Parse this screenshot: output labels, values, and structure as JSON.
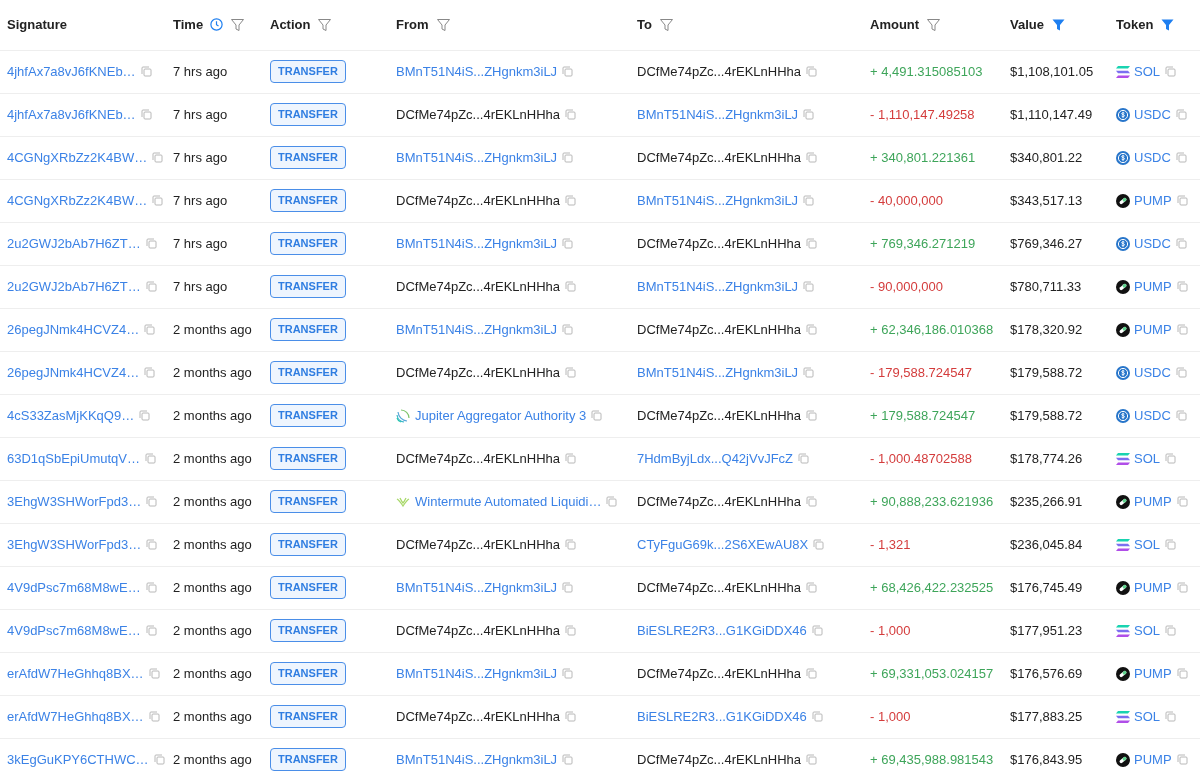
{
  "columns": [
    {
      "label": "Signature",
      "filterable": false,
      "sorted": false
    },
    {
      "label": "Time",
      "filterable": true,
      "filter_active": false,
      "sorted": true
    },
    {
      "label": "Action",
      "filterable": true,
      "filter_active": false,
      "sorted": false
    },
    {
      "label": "From",
      "filterable": true,
      "filter_active": false,
      "sorted": false
    },
    {
      "label": "To",
      "filterable": true,
      "filter_active": false,
      "sorted": false
    },
    {
      "label": "Amount",
      "filterable": true,
      "filter_active": false,
      "sorted": false
    },
    {
      "label": "Value",
      "filterable": true,
      "filter_active": true,
      "sorted": false
    },
    {
      "label": "Token",
      "filterable": true,
      "filter_active": true,
      "sorted": false
    }
  ],
  "rows": [
    {
      "signature": "4jhfAx7a8vJ6fKNEb…",
      "time": "7 hrs ago",
      "action": "TRANSFER",
      "from": {
        "text": "BMnT51N4iS...ZHgnkm3iLJ",
        "link": true
      },
      "to": {
        "text": "DCfMe74pZc...4rEKLnHHha",
        "link": false
      },
      "amount": "+ 4,491.315085103",
      "incoming": true,
      "value": "$1,108,101.05",
      "token": {
        "symbol": "SOL",
        "kind": "sol"
      }
    },
    {
      "signature": "4jhfAx7a8vJ6fKNEb…",
      "time": "7 hrs ago",
      "action": "TRANSFER",
      "from": {
        "text": "DCfMe74pZc...4rEKLnHHha",
        "link": false
      },
      "to": {
        "text": "BMnT51N4iS...ZHgnkm3iLJ",
        "link": true
      },
      "amount": "- 1,110,147.49258",
      "incoming": false,
      "value": "$1,110,147.49",
      "token": {
        "symbol": "USDC",
        "kind": "usdc"
      }
    },
    {
      "signature": "4CGNgXRbZz2K4BW…",
      "time": "7 hrs ago",
      "action": "TRANSFER",
      "from": {
        "text": "BMnT51N4iS...ZHgnkm3iLJ",
        "link": true
      },
      "to": {
        "text": "DCfMe74pZc...4rEKLnHHha",
        "link": false
      },
      "amount": "+ 340,801.221361",
      "incoming": true,
      "value": "$340,801.22",
      "token": {
        "symbol": "USDC",
        "kind": "usdc"
      }
    },
    {
      "signature": "4CGNgXRbZz2K4BW…",
      "time": "7 hrs ago",
      "action": "TRANSFER",
      "from": {
        "text": "DCfMe74pZc...4rEKLnHHha",
        "link": false
      },
      "to": {
        "text": "BMnT51N4iS...ZHgnkm3iLJ",
        "link": true
      },
      "amount": "- 40,000,000",
      "incoming": false,
      "value": "$343,517.13",
      "token": {
        "symbol": "PUMP",
        "kind": "pump"
      }
    },
    {
      "signature": "2u2GWJ2bAb7H6ZT…",
      "time": "7 hrs ago",
      "action": "TRANSFER",
      "from": {
        "text": "BMnT51N4iS...ZHgnkm3iLJ",
        "link": true
      },
      "to": {
        "text": "DCfMe74pZc...4rEKLnHHha",
        "link": false
      },
      "amount": "+ 769,346.271219",
      "incoming": true,
      "value": "$769,346.27",
      "token": {
        "symbol": "USDC",
        "kind": "usdc"
      }
    },
    {
      "signature": "2u2GWJ2bAb7H6ZT…",
      "time": "7 hrs ago",
      "action": "TRANSFER",
      "from": {
        "text": "DCfMe74pZc...4rEKLnHHha",
        "link": false
      },
      "to": {
        "text": "BMnT51N4iS...ZHgnkm3iLJ",
        "link": true
      },
      "amount": "- 90,000,000",
      "incoming": false,
      "value": "$780,711.33",
      "token": {
        "symbol": "PUMP",
        "kind": "pump"
      }
    },
    {
      "signature": "26pegJNmk4HCVZ4…",
      "time": "2 months ago",
      "action": "TRANSFER",
      "from": {
        "text": "BMnT51N4iS...ZHgnkm3iLJ",
        "link": true
      },
      "to": {
        "text": "DCfMe74pZc...4rEKLnHHha",
        "link": false
      },
      "amount": "+ 62,346,186.010368",
      "incoming": true,
      "value": "$178,320.92",
      "token": {
        "symbol": "PUMP",
        "kind": "pump"
      }
    },
    {
      "signature": "26pegJNmk4HCVZ4…",
      "time": "2 months ago",
      "action": "TRANSFER",
      "from": {
        "text": "DCfMe74pZc...4rEKLnHHha",
        "link": false
      },
      "to": {
        "text": "BMnT51N4iS...ZHgnkm3iLJ",
        "link": true
      },
      "amount": "- 179,588.724547",
      "incoming": false,
      "value": "$179,588.72",
      "token": {
        "symbol": "USDC",
        "kind": "usdc"
      }
    },
    {
      "signature": "4cS33ZasMjKKqQ9…",
      "time": "2 months ago",
      "action": "TRANSFER",
      "from": {
        "text": "Jupiter Aggregator Authority 3",
        "link": true,
        "kind": "jupiter"
      },
      "to": {
        "text": "DCfMe74pZc...4rEKLnHHha",
        "link": false
      },
      "amount": "+ 179,588.724547",
      "incoming": true,
      "value": "$179,588.72",
      "token": {
        "symbol": "USDC",
        "kind": "usdc"
      }
    },
    {
      "signature": "63D1qSbEpiUmutqV…",
      "time": "2 months ago",
      "action": "TRANSFER",
      "from": {
        "text": "DCfMe74pZc...4rEKLnHHha",
        "link": false
      },
      "to": {
        "text": "7HdmByjLdx...Q42jVvJFcZ",
        "link": true
      },
      "amount": "- 1,000.48702588",
      "incoming": false,
      "value": "$178,774.26",
      "token": {
        "symbol": "SOL",
        "kind": "sol"
      }
    },
    {
      "signature": "3EhgW3SHWorFpd3…",
      "time": "2 months ago",
      "action": "TRANSFER",
      "from": {
        "text": "Wintermute Automated Liquidi…",
        "link": true,
        "kind": "wintermute"
      },
      "to": {
        "text": "DCfMe74pZc...4rEKLnHHha",
        "link": false
      },
      "amount": "+ 90,888,233.621936",
      "incoming": true,
      "value": "$235,266.91",
      "token": {
        "symbol": "PUMP",
        "kind": "pump"
      }
    },
    {
      "signature": "3EhgW3SHWorFpd3…",
      "time": "2 months ago",
      "action": "TRANSFER",
      "from": {
        "text": "DCfMe74pZc...4rEKLnHHha",
        "link": false
      },
      "to": {
        "text": "CTyFguG69k...2S6XEwAU8X",
        "link": true
      },
      "amount": "- 1,321",
      "incoming": false,
      "value": "$236,045.84",
      "token": {
        "symbol": "SOL",
        "kind": "sol"
      }
    },
    {
      "signature": "4V9dPsc7m68M8wE…",
      "time": "2 months ago",
      "action": "TRANSFER",
      "from": {
        "text": "BMnT51N4iS...ZHgnkm3iLJ",
        "link": true
      },
      "to": {
        "text": "DCfMe74pZc...4rEKLnHHha",
        "link": false
      },
      "amount": "+ 68,426,422.232525",
      "incoming": true,
      "value": "$176,745.49",
      "token": {
        "symbol": "PUMP",
        "kind": "pump"
      }
    },
    {
      "signature": "4V9dPsc7m68M8wE…",
      "time": "2 months ago",
      "action": "TRANSFER",
      "from": {
        "text": "DCfMe74pZc...4rEKLnHHha",
        "link": false
      },
      "to": {
        "text": "BiESLRE2R3...G1KGiDDX46",
        "link": true
      },
      "amount": "- 1,000",
      "incoming": false,
      "value": "$177,951.23",
      "token": {
        "symbol": "SOL",
        "kind": "sol"
      }
    },
    {
      "signature": "erAfdW7HeGhhq8BX…",
      "time": "2 months ago",
      "action": "TRANSFER",
      "from": {
        "text": "BMnT51N4iS...ZHgnkm3iLJ",
        "link": true
      },
      "to": {
        "text": "DCfMe74pZc...4rEKLnHHha",
        "link": false
      },
      "amount": "+ 69,331,053.024157",
      "incoming": true,
      "value": "$176,576.69",
      "token": {
        "symbol": "PUMP",
        "kind": "pump"
      }
    },
    {
      "signature": "erAfdW7HeGhhq8BX…",
      "time": "2 months ago",
      "action": "TRANSFER",
      "from": {
        "text": "DCfMe74pZc...4rEKLnHHha",
        "link": false
      },
      "to": {
        "text": "BiESLRE2R3...G1KGiDDX46",
        "link": true
      },
      "amount": "- 1,000",
      "incoming": false,
      "value": "$177,883.25",
      "token": {
        "symbol": "SOL",
        "kind": "sol"
      }
    },
    {
      "signature": "3kEgGuKPY6CTHWC…",
      "time": "2 months ago",
      "action": "TRANSFER",
      "from": {
        "text": "BMnT51N4iS...ZHgnkm3iLJ",
        "link": true
      },
      "to": {
        "text": "DCfMe74pZc...4rEKLnHHha",
        "link": false
      },
      "amount": "+ 69,435,988.981543",
      "incoming": true,
      "value": "$176,843.95",
      "token": {
        "symbol": "PUMP",
        "kind": "pump"
      }
    }
  ]
}
